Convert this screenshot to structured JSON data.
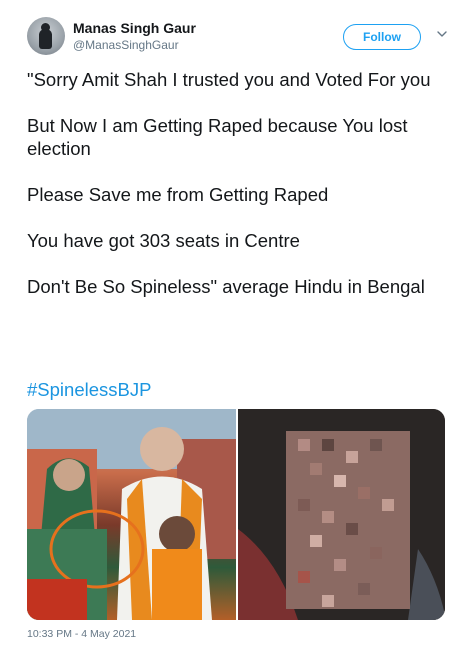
{
  "user": {
    "display_name": "Manas Singh Gaur",
    "handle": "@ManasSinghGaur"
  },
  "follow_button": {
    "label": "Follow"
  },
  "tweet": {
    "paragraphs": [
      "\"Sorry Amit Shah I trusted you and Voted For you",
      "But Now I am Getting Raped because You lost election",
      "Please Save me from Getting Raped",
      "You have got 303 seats in Centre",
      "Don't Be So Spineless\" average Hindu in Bengal"
    ],
    "hashtag": "#SpinelessBJP",
    "timestamp": "10:33 PM - 4 May 2021"
  },
  "media": {
    "count": 2,
    "items": [
      {
        "icon": "photo-politician-group"
      },
      {
        "icon": "photo-pixelated"
      }
    ]
  },
  "icons": {
    "chevron": "chevron-down-icon",
    "avatar": "avatar"
  },
  "colors": {
    "accent": "#1da1f2",
    "hashtag": "#1b95e0",
    "muted": "#657786",
    "text": "#14171a"
  }
}
